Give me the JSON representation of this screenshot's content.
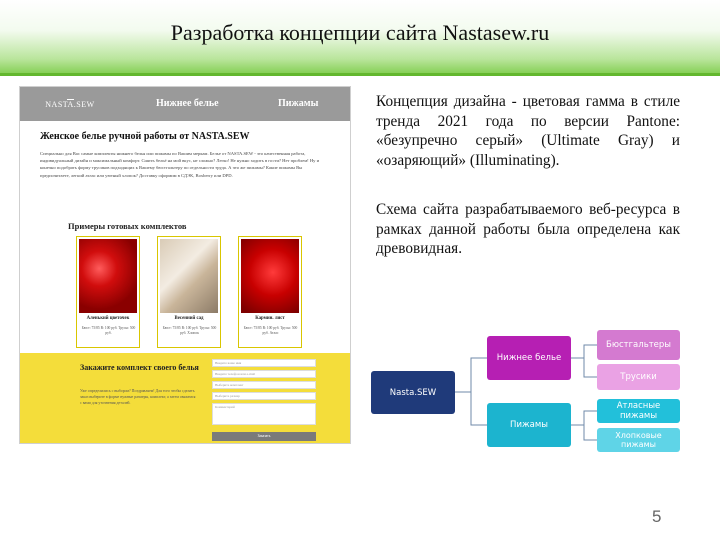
{
  "slide": {
    "title": "Разработка концепции сайта Nastasew.ru",
    "page_number": "5"
  },
  "screenshot": {
    "logo": "NASTA.SEW",
    "nav": [
      "Нижнее белье",
      "Пижамы"
    ],
    "heading": "Женское белье ручной работы от NASTA.SEW",
    "intro": "Специально для Вас самые комплекты нижнего белья или пижамы по Вашим меркам. Белье от NASTA.SEW - это качественная работа, индивидуальный дизайн и максимальный комфорт. Сшить бельё на мой вкус, не сложно? Легко! Не нужно ходить в гости? Нет проблем! Ну и конечно подобрать форму трусиков подходящих к Вашему бюстгальтеру по отдельности труда. А что же пижамы? Какие пижамы Вы предпочитаете, легкий атлас или уютный хлопок? Доставку оформим в СДЭК, Boxberry или DPD.",
    "examples_heading": "Примеры готовых комплектов",
    "cards": [
      {
        "name": "Аленький цветочек",
        "desc": "Бюст: 75/85 В: 100 руб. Трусы: 500 руб."
      },
      {
        "name": "Весенний сад",
        "desc": "Бюст: 75/85 В: 100 руб. Трусы: 500 руб. Хлопок"
      },
      {
        "name": "Кармин. лист",
        "desc": "Бюст: 75/85 В: 100 руб. Трусы: 500 руб. Атлас"
      }
    ],
    "order_heading": "Закажите комплект своего белья",
    "order_text": "Уже определились с выбором? Поздравляем! Для того чтобы сделать заказ выберите в форме нужные размеры, комплект, а затем свяжемся с вами для уточнения деталей.",
    "form": {
      "fields": [
        "Введите ваше имя",
        "Введите телефон или e-mail",
        "Выберите комплект",
        "Выберите размер",
        "Комментарий"
      ],
      "submit": "Заказать"
    }
  },
  "text": {
    "concept": "Концепция дизайна - цветовая гамма в стиле тренда 2021 года по версии Pantone: «безупречно серый» (Ultimate Gray) и «озаряющий» (Illuminating).",
    "scheme": "Схема сайта разрабатываемого веб-ресурса в рамках данной работы была определена как древовидная."
  },
  "diagram": {
    "root": "Nasta.SEW",
    "branches": [
      {
        "label": "Нижнее белье",
        "children": [
          "Бюстгальтеры",
          "Трусики"
        ]
      },
      {
        "label": "Пижамы",
        "children": [
          "Атласные пижамы",
          "Хлопковые пижамы"
        ]
      }
    ]
  },
  "colors": {
    "header_green": "#7ccc49",
    "root_blue": "#1f3a7a",
    "magenta": "#b61fb3",
    "cyan": "#1cb4cf"
  }
}
